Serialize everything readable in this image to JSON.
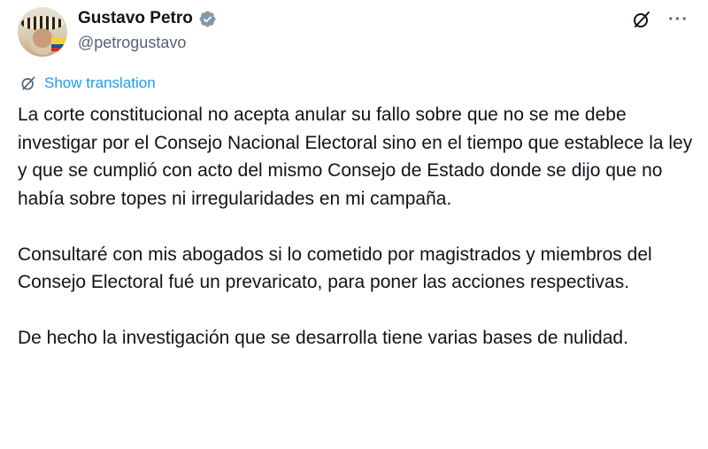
{
  "author": {
    "display_name": "Gustavo Petro",
    "handle": "@petrogustavo",
    "verified": true
  },
  "actions": {
    "grok_icon": "grok-slash-circle-icon",
    "more_icon": "more-horizontal-icon",
    "more_label": "···"
  },
  "translation": {
    "label": "Show translation",
    "icon": "translate-icon"
  },
  "tweet": {
    "paragraphs": [
      "La corte constitucional no acepta anular su fallo sobre que no se me debe investigar por el Consejo Nacional Electoral sino en el tiempo que establece la ley y que se cumplió con acto del mismo Consejo de Estado donde se dijo que no había sobre topes ni irregularidades en mi campaña.",
      "Consultaré con mis abogados si lo cometido por magistrados y miembros del Consejo Electoral fué un prevaricato, para poner las acciones respectivas.",
      "De hecho la investigación que se desarrolla tiene varias bases de nulidad."
    ]
  },
  "colors": {
    "link": "#1d9bf0",
    "secondary_text": "#536471",
    "primary_text": "#0f1419",
    "verified": "#829aab"
  }
}
